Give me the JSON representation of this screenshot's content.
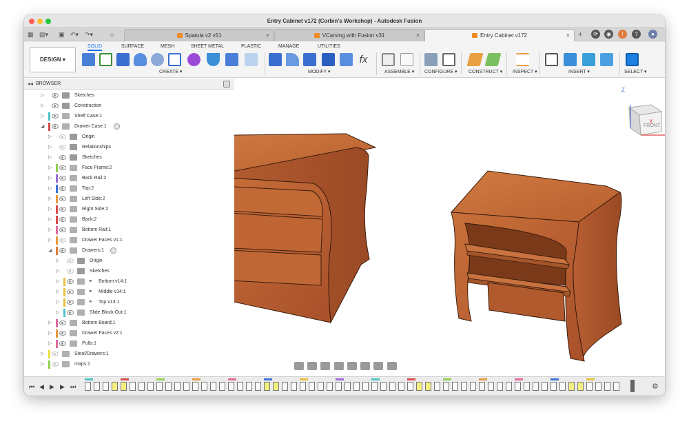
{
  "window": {
    "title": "Entry Cabinet v172 (Corbin's Workshop) - Autodesk Fusion"
  },
  "tabs": [
    {
      "label": "Spatula v2 v51",
      "active": false
    },
    {
      "label": "VCarving with Fusion v31",
      "active": false
    },
    {
      "label": "Entry Cabinet v172",
      "active": true
    }
  ],
  "toolbar": {
    "workspace": "DESIGN",
    "workspace_tabs": [
      "SOLID",
      "SURFACE",
      "MESH",
      "SHEET METAL",
      "PLASTIC",
      "MANAGE",
      "UTILITIES"
    ],
    "groups": [
      "CREATE",
      "MODIFY",
      "ASSEMBLE",
      "CONFIGURE",
      "CONSTRUCT",
      "INSPECT",
      "INSERT",
      "SELECT"
    ]
  },
  "browser": {
    "title": "BROWSER",
    "items": [
      {
        "label": "Sketches",
        "color": ""
      },
      {
        "label": "Construction",
        "color": ""
      },
      {
        "label": "Shelf Case:1",
        "color": "#4ec3c7"
      },
      {
        "label": "Drawer Case:1",
        "color": "#d94a4a"
      },
      {
        "label": "Origin",
        "color": ""
      },
      {
        "label": "Relationships",
        "color": ""
      },
      {
        "label": "Sketches",
        "color": ""
      },
      {
        "label": "Face Frame:2",
        "color": "#8fd14f"
      },
      {
        "label": "Back Rail:2",
        "color": "#9b6ad6"
      },
      {
        "label": "Top:2",
        "color": "#3f6fd8"
      },
      {
        "label": "Left Side:2",
        "color": "#e89a3c"
      },
      {
        "label": "Right Side:2",
        "color": "#d94a4a"
      },
      {
        "label": "Back:2",
        "color": "#d94a4a"
      },
      {
        "label": "Bottom Rail:1",
        "color": "#e06aa0"
      },
      {
        "label": "Drawer Faces v1:1",
        "color": "#e89a3c"
      },
      {
        "label": "Drawers:1",
        "color": "#e07a3c"
      },
      {
        "label": "Origin",
        "color": ""
      },
      {
        "label": "Sketches",
        "color": ""
      },
      {
        "label": "Bottom v14:1",
        "color": "#e8c13c"
      },
      {
        "label": "Middle v14:1",
        "color": "#e8c13c"
      },
      {
        "label": "Top v13:1",
        "color": "#e8c13c"
      },
      {
        "label": "Slide Block Out:1",
        "color": "#4ec3c7"
      },
      {
        "label": "Bottom Board:1",
        "color": "#e06aa0"
      },
      {
        "label": "Drawer Faces v2:1",
        "color": "#e89a3c"
      },
      {
        "label": "Pulls:1",
        "color": "#e06aa0"
      },
      {
        "label": "Stool/Drawers:1",
        "color": "#e8e03c"
      },
      {
        "label": "maps:1",
        "color": "#8fd14f"
      }
    ]
  },
  "viewcube": {
    "face": "FRONT",
    "axis_z": "Z",
    "axis_x": "X"
  }
}
